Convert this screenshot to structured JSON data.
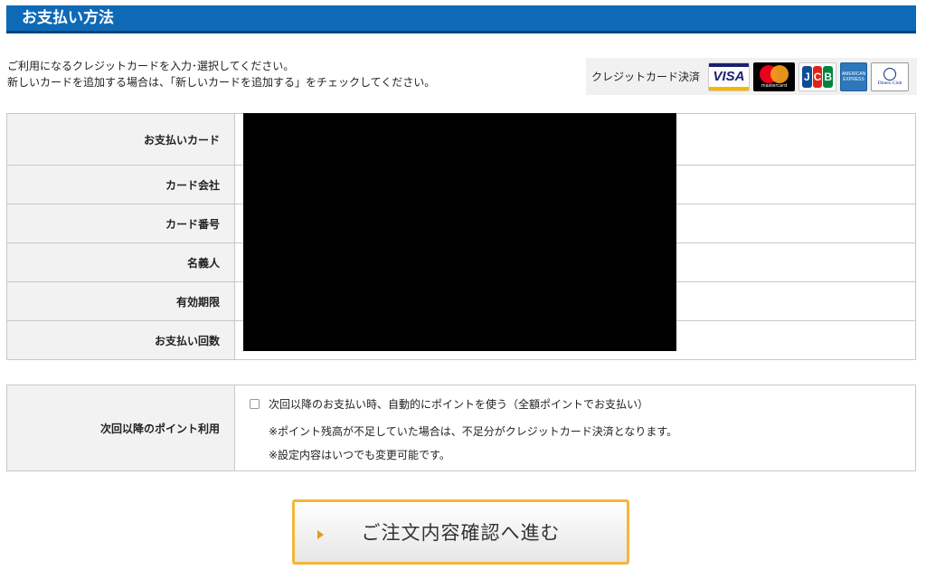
{
  "header": {
    "title": "お支払い方法"
  },
  "intro": {
    "line1": "ご利用になるクレジットカードを入力･選択してください。",
    "line2": "新しいカードを追加する場合は、「新しいカードを追加する」をチェックしてください。"
  },
  "brands": {
    "label": "クレジットカード決済",
    "visa": "VISA",
    "mastercard": "mastercard",
    "jcb": [
      "J",
      "C",
      "B"
    ],
    "amex": "AMERICAN EXPRESS",
    "diners": "Diners Club"
  },
  "card_table": {
    "rows": [
      {
        "label": "お支払いカード"
      },
      {
        "label": "カード会社"
      },
      {
        "label": "カード番号"
      },
      {
        "label": "名義人"
      },
      {
        "label": "有効期限"
      },
      {
        "label": "お支払い回数"
      }
    ]
  },
  "points": {
    "label": "次回以降のポイント利用",
    "checkbox_label": "次回以降のお支払い時、自動的にポイントを使う（全額ポイントでお支払い）",
    "checked": false,
    "note1": "※ポイント残高が不足していた場合は、不足分がクレジットカード決済となります。",
    "note2": "※設定内容はいつでも変更可能です。"
  },
  "confirm_button": {
    "label": "ご注文内容確認へ進む"
  },
  "colors": {
    "header_bg": "#0e6ab6",
    "table_header_bg": "#f2f2f2",
    "button_border": "#f5b63a",
    "arrow": "#e49a1c"
  }
}
